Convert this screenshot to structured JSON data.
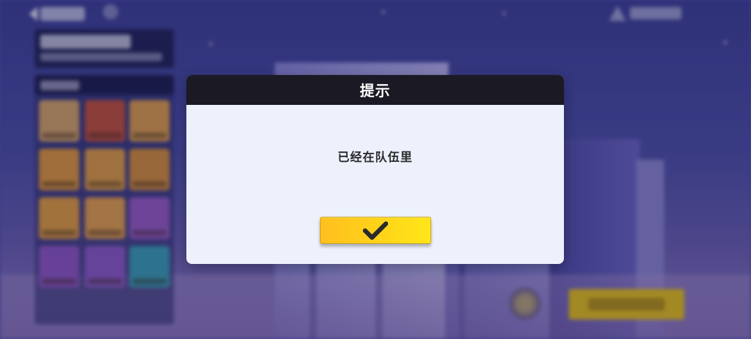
{
  "dialog": {
    "title": "提示",
    "message": "已经在队伍里",
    "confirm_icon": "check-icon"
  },
  "colors": {
    "dialog_header": "#1b1a24",
    "dialog_body": "#edf1fb",
    "confirm_button": "#ffd21a",
    "start_button": "#e8c21a",
    "background": "#3c3f96"
  },
  "background_ui": {
    "back_icon": "chevron-left-icon",
    "help_icon": "question-icon",
    "top_right_icon": "hat-icon"
  }
}
